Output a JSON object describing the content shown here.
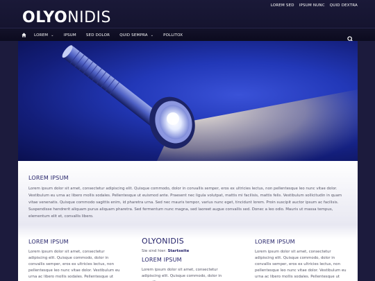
{
  "site": {
    "logo_bold": "OLYO",
    "logo_light": "NIDIS"
  },
  "toplinks": [
    "LOREM SED",
    "IPSUM NUNC",
    "QUID DEXTRA"
  ],
  "nav": {
    "items": [
      {
        "label": "LOREM",
        "has_caret": true
      },
      {
        "label": "IPSUM",
        "has_caret": false
      },
      {
        "label": "SED DOLOR",
        "has_caret": false
      },
      {
        "label": "QUID SEMPRA",
        "has_caret": true
      },
      {
        "label": "POLLITOX",
        "has_caret": false
      }
    ]
  },
  "hero": {
    "icon": "flashlight-image"
  },
  "intro": {
    "heading": "LOREM IPSUM",
    "text": "Lorem ipsum dolor sit amet, consectetur adipiscing elit. Quisque commodo, dolor in convallis semper, eros ex ultricies lectus, non pellentesque leo nunc vitae dolor. Vestibulum eu urna ac libero mollis sodales. Pellentesque ut euismod ante. Praesent nec ligula volutpat, mattis mi facilisis, mattis felis. Vestibulum sollicitudin in quam vitae venenatis. Quisque commodo sagittis enim, id pharetra urna. Sed nec mauris tempor, varius nunc eget, tincidunt lorem. Proin suscipit auctor ipsum ac facilisis. Suspendisse hendrerit aliquam purus aliquam pharetra. Sed fermentum nunc magna, sed laoreet augue convallis sed. Donec a leo odio. Mauris ut massa tempus, elementum elit et, convallis libero."
  },
  "columns": {
    "left": {
      "heading": "LOREM IPSUM",
      "text": "Lorem ipsum dolor sit amet, consectetur adipiscing elit. Quisque commodo, dolor in convallis semper, eros ex ultricies lectus, non pellentesque leo nunc vitae dolor. Vestibulum eu urna ac libero mollis sodales. Pellentesque ut euismod ante. Praesent nec"
    },
    "middle": {
      "site_title": "OLYONIDIS",
      "breadcrumb_prefix": "Sie sind hier: ",
      "breadcrumb_link": "Startseite",
      "heading": "LOREM IPSUM",
      "text": "Lorem ipsum dolor sit amet, consectetur adipiscing elit. Quisque commodo, dolor in convallis semper,"
    },
    "right": {
      "heading": "LOREM IPSUM",
      "text": "Lorem ipsum dolor sit amet, consectetur adipiscing elit. Quisque commodo, dolor in convallis semper, eros ex ultricies lectus, non pellentesque leo nunc vitae dolor. Vestibulum eu urna ac libero mollis sodales. Pellentesque ut euismod ante. Praesent nec"
    }
  },
  "colors": {
    "header_bg": "#1a1938",
    "heading": "#25236a",
    "body_text": "#555566"
  }
}
